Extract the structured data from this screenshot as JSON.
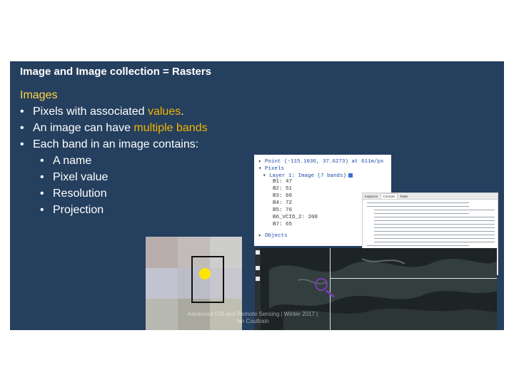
{
  "slide": {
    "title": "Image and Image collection = Rasters",
    "heading": "Images",
    "bullets": [
      {
        "pre": "Pixels with associated ",
        "hl": "values",
        "post": "."
      },
      {
        "pre": "An image can have ",
        "hl": "multiple bands",
        "post": ""
      },
      {
        "pre": "Each band in an image contains:",
        "hl": "",
        "post": ""
      }
    ],
    "sub_bullets": [
      "A name",
      "Pixel value",
      "Resolution",
      "Projection"
    ],
    "bullet_char": "•",
    "footer_line1": "Advanced GIS and Remote Sensing | Winter 2017 |",
    "footer_line2": "Ian Coultrain"
  },
  "inspector": {
    "point": "Point (-115.1036, 37.6273) at 611m/px",
    "pixels_label": "Pixels",
    "layer": "Layer 1: Image (7 bands)",
    "bands": [
      "B1: 47",
      "B2: 51",
      "B3: 60",
      "B4: 72",
      "B5: 76",
      "B6_VCID_2: 208",
      "B7: 65"
    ],
    "objects_label": "Objects"
  },
  "console": {
    "tabs": [
      "Inspector",
      "Console",
      "Tasks"
    ]
  },
  "colors": {
    "slide_bg": "#253f5e",
    "highlight": "#f4b400",
    "heading": "#ffd54a",
    "lens": "#7a3fb0"
  },
  "grid_colors": [
    "#b7aeac",
    "#c2bbbb",
    "#cdcdcb",
    "#c1c3d0",
    "#bcbcc9",
    "#c7c5cd",
    "#b8b9b1",
    "#a9a9a0",
    "#bfbfb1"
  ]
}
